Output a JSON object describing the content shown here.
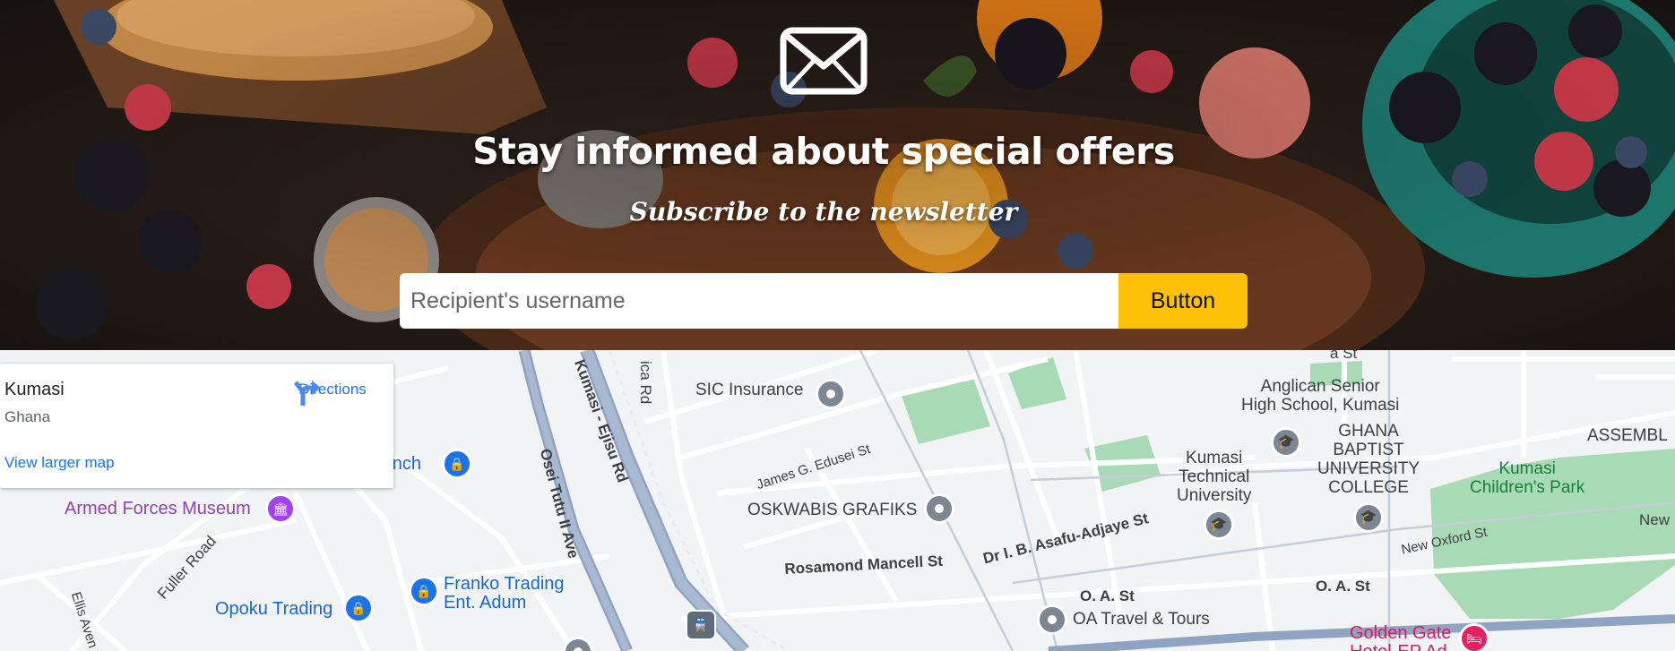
{
  "newsletter": {
    "title": "Stay informed about special offers",
    "subtitle": "Subscribe to the newsletter",
    "input_placeholder": "Recipient's username",
    "button_label": "Button",
    "icon": "envelope-icon",
    "button_color": "#ffc107"
  },
  "map": {
    "info_card": {
      "place": "Kumasi",
      "country": "Ghana",
      "directions_label": "Directions",
      "larger_map_link": "View larger map"
    },
    "labels": {
      "sic_insurance": "SIC Insurance",
      "anglican_line1": "Anglican Senior",
      "anglican_line2": "High School, Kumasi",
      "gbuc_line1": "GHANA",
      "gbuc_line2": "BAPTIST",
      "gbuc_line3": "UNIVERSITY",
      "gbuc_line4": "COLLEGE",
      "assembl": "ASSEMBL",
      "ktu_line1": "Kumasi",
      "ktu_line2": "Technical",
      "ktu_line3": "University",
      "branch": "ranch",
      "armed_forces_museum": "Armed Forces Museum",
      "oskwabis": "OSKWABIS GRAFIKS",
      "franko_line1": "Franko Trading",
      "franko_line2": "Ent. Adum",
      "opoku_trading": "Opoku Trading",
      "oa_travel": "OA Travel & Tours",
      "kumasi_children_park_line1": "Kumasi",
      "kumasi_children_park_line2": "Children's Park",
      "golden_gate_line1": "Golden Gate",
      "golden_gate_line2": "Hotel-EP Ad",
      "new_top": "New",
      "oa_street_1": "O. A. St",
      "oa_street_2": "O. A. St",
      "ica_rd": "ica Rd",
      "kumasi_ejisu_rd": "Kumasi - Ejisu Rd",
      "osei_tutu_ave": "Osei Tutu II Ave",
      "james_edusei_st": "James G. Edusei St",
      "asafu_adjaye_st": "Dr I. B. Asafu-Adjaye St",
      "rosamond_mancell_st": "Rosamond Mancell St",
      "new_oxford_st": "New Oxford St",
      "fuller_road": "Fuller Road",
      "ellis_ave": "Ellis Aven",
      "top_st": "a St"
    }
  }
}
